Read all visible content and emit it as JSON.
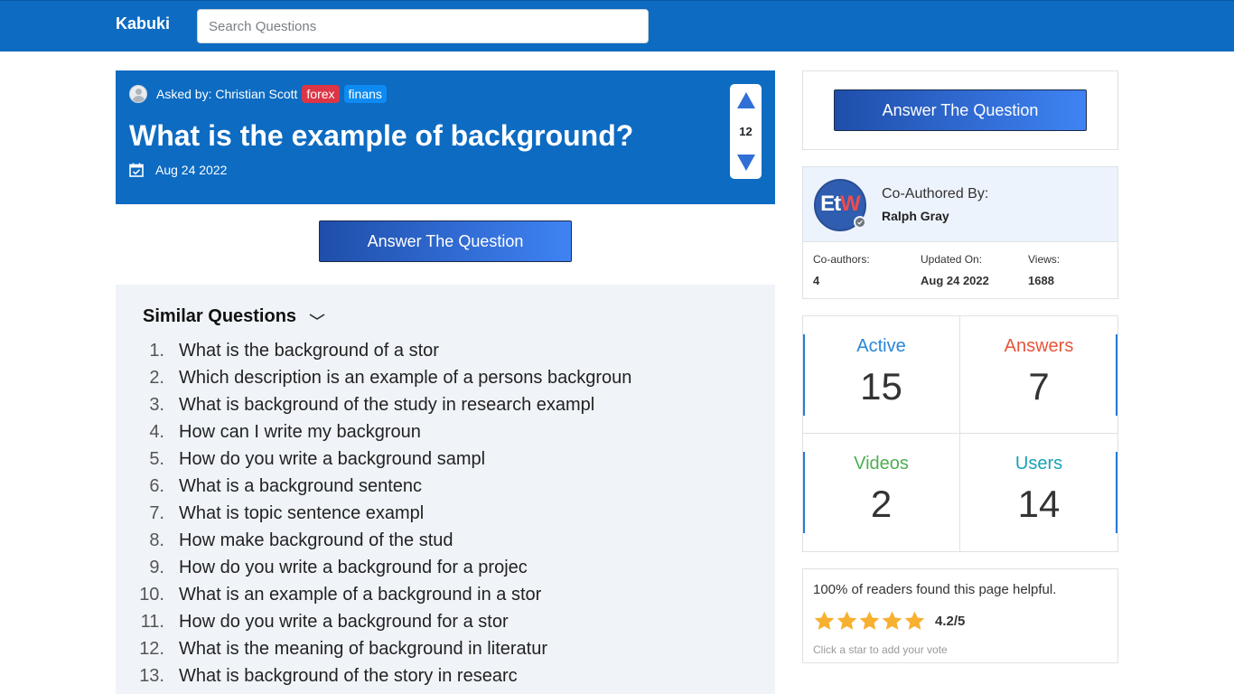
{
  "nav": {
    "brand": "Kabuki",
    "search_placeholder": "Search Questions"
  },
  "question": {
    "asked_by": "Asked by: Christian Scott",
    "tags": [
      "forex",
      "finans"
    ],
    "title": "What is the example of background?",
    "date": "Aug 24 2022",
    "votes": "12"
  },
  "buttons": {
    "answer_label": "Answer The Question"
  },
  "similar": {
    "heading": "Similar Questions",
    "items": [
      {
        "num": "1.",
        "text": "What is the background of a stor"
      },
      {
        "num": "2.",
        "text": "Which description is an example of a persons backgroun"
      },
      {
        "num": "3.",
        "text": "What is background of the study in research exampl"
      },
      {
        "num": "4.",
        "text": "How can I write my backgroun"
      },
      {
        "num": "5.",
        "text": "How do you write a background sampl"
      },
      {
        "num": "6.",
        "text": "What is a background sentenc"
      },
      {
        "num": "7.",
        "text": "What is topic sentence exampl"
      },
      {
        "num": "8.",
        "text": "How make background of the stud"
      },
      {
        "num": "9.",
        "text": "How do you write a background for a projec"
      },
      {
        "num": "10.",
        "text": "What is an example of a background in a stor"
      },
      {
        "num": "11.",
        "text": "How do you write a background for a stor"
      },
      {
        "num": "12.",
        "text": "What is the meaning of background in literatur"
      },
      {
        "num": "13.",
        "text": "What is background of the story in researc"
      }
    ]
  },
  "author": {
    "logo_et": "Et",
    "logo_w": "W",
    "co_label": "Co-Authored By:",
    "name": "Ralph Gray",
    "meta": [
      {
        "label": "Co-authors:",
        "value": "4"
      },
      {
        "label": "Updated On:",
        "value": "Aug 24 2022"
      },
      {
        "label": "Views:",
        "value": "1688"
      }
    ]
  },
  "stats": {
    "active": {
      "label": "Active",
      "value": "15",
      "color": "#2a86d8"
    },
    "answers": {
      "label": "Answers",
      "value": "7",
      "color": "#e8553a"
    },
    "videos": {
      "label": "Videos",
      "value": "2",
      "color": "#4caf50"
    },
    "users": {
      "label": "Users",
      "value": "14",
      "color": "#17a2b8"
    }
  },
  "rating": {
    "helpful": "100% of readers found this page helpful.",
    "score": "4.2/5",
    "stars_filled": 5,
    "hint": "Click a star to add your vote",
    "star_color": "#f7b030"
  },
  "colors": {
    "primary": "#0d6bc2",
    "tag_red": "#dc3545",
    "tag_blue": "#0d8bf2"
  }
}
